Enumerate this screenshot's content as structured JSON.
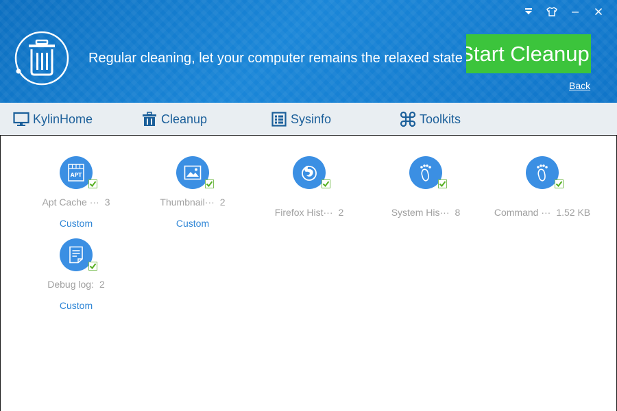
{
  "header": {
    "slogan": "Regular cleaning, let your computer remains the relaxed state",
    "start_label": "Start Cleanup",
    "back_label": "Back"
  },
  "nav": [
    {
      "label": "KylinHome",
      "icon": "monitor-icon"
    },
    {
      "label": "Cleanup",
      "icon": "trash-icon"
    },
    {
      "label": "Sysinfo",
      "icon": "sysinfo-icon"
    },
    {
      "label": "Toolkits",
      "icon": "command-icon"
    }
  ],
  "items": [
    {
      "name": "Apt Cache ···",
      "value": "3",
      "custom": "Custom",
      "icon": "apt-icon"
    },
    {
      "name": "Thumbnail···",
      "value": "2",
      "custom": "Custom",
      "icon": "image-icon"
    },
    {
      "name": "Firefox Hist···",
      "value": "2",
      "custom": "",
      "icon": "firefox-icon"
    },
    {
      "name": "System His···",
      "value": "8",
      "custom": "",
      "icon": "footprint-icon"
    },
    {
      "name": "Command ···",
      "value": "1.52 KB",
      "custom": "",
      "icon": "footprint-icon"
    },
    {
      "name": "Debug log:",
      "value": "2",
      "custom": "Custom",
      "icon": "document-icon"
    }
  ],
  "colors": {
    "header": "#1a86d8",
    "start_button": "#3cc43c",
    "accent": "#2f86d6",
    "icon_circle": "#3b8fe3"
  }
}
